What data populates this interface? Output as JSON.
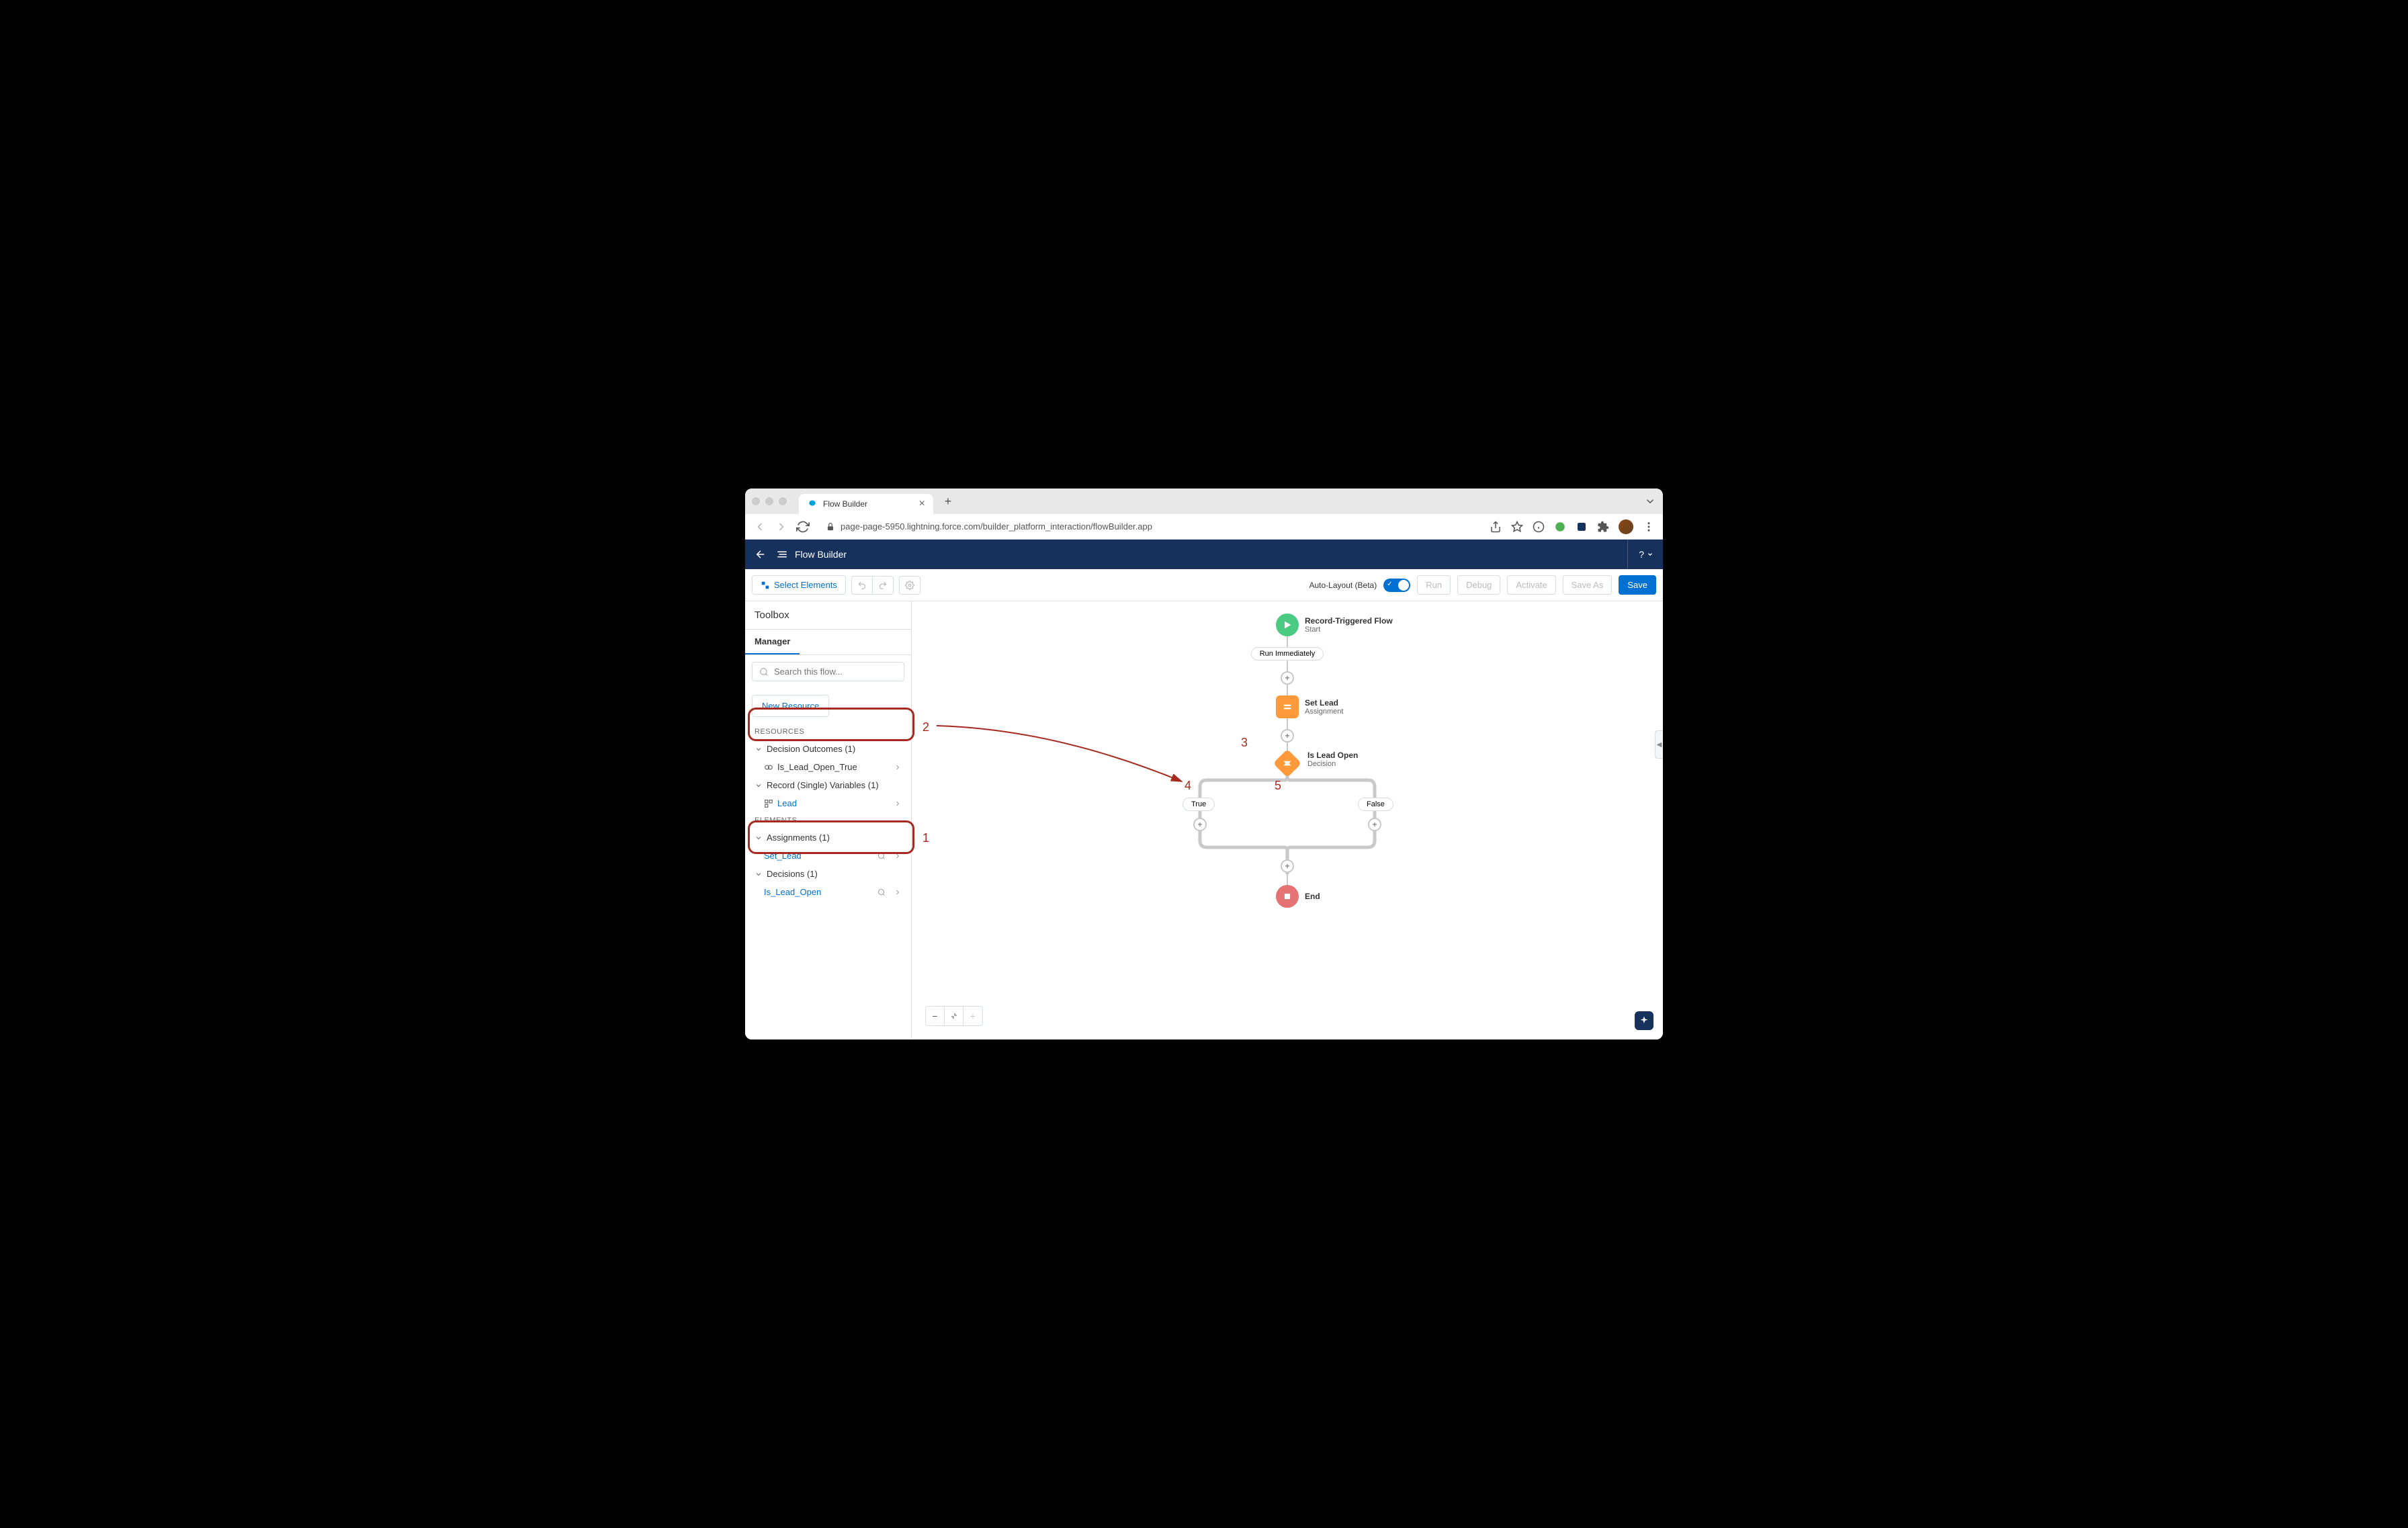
{
  "browser": {
    "tab_title": "Flow Builder",
    "url": "page-page-5950.lightning.force.com/builder_platform_interaction/flowBuilder.app"
  },
  "header": {
    "app_title": "Flow Builder",
    "help": "?"
  },
  "toolbar": {
    "select_elements": "Select Elements",
    "auto_layout": "Auto-Layout (Beta)",
    "run": "Run",
    "debug": "Debug",
    "activate": "Activate",
    "save_as": "Save As",
    "save": "Save"
  },
  "sidebar": {
    "title": "Toolbox",
    "tab": "Manager",
    "search_placeholder": "Search this flow...",
    "new_resource": "New Resource",
    "resources_label": "RESOURCES",
    "elements_label": "ELEMENTS",
    "decision_outcomes": "Decision Outcomes (1)",
    "outcome_item": "Is_Lead_Open_True",
    "record_vars": "Record (Single) Variables (1)",
    "record_item": "Lead",
    "assignments": "Assignments (1)",
    "assignment_item": "Set_Lead",
    "decisions": "Decisions (1)",
    "decision_item": "Is_Lead_Open"
  },
  "canvas": {
    "start_title": "Record-Triggered Flow",
    "start_subtitle": "Start",
    "run_immediately": "Run Immediately",
    "setlead_title": "Set Lead",
    "setlead_subtitle": "Assignment",
    "decision_title": "Is Lead Open",
    "decision_subtitle": "Decision",
    "branch_true": "True",
    "branch_false": "False",
    "end_label": "End"
  },
  "annotations": {
    "n1": "1",
    "n2": "2",
    "n3": "3",
    "n4": "4",
    "n5": "5"
  }
}
